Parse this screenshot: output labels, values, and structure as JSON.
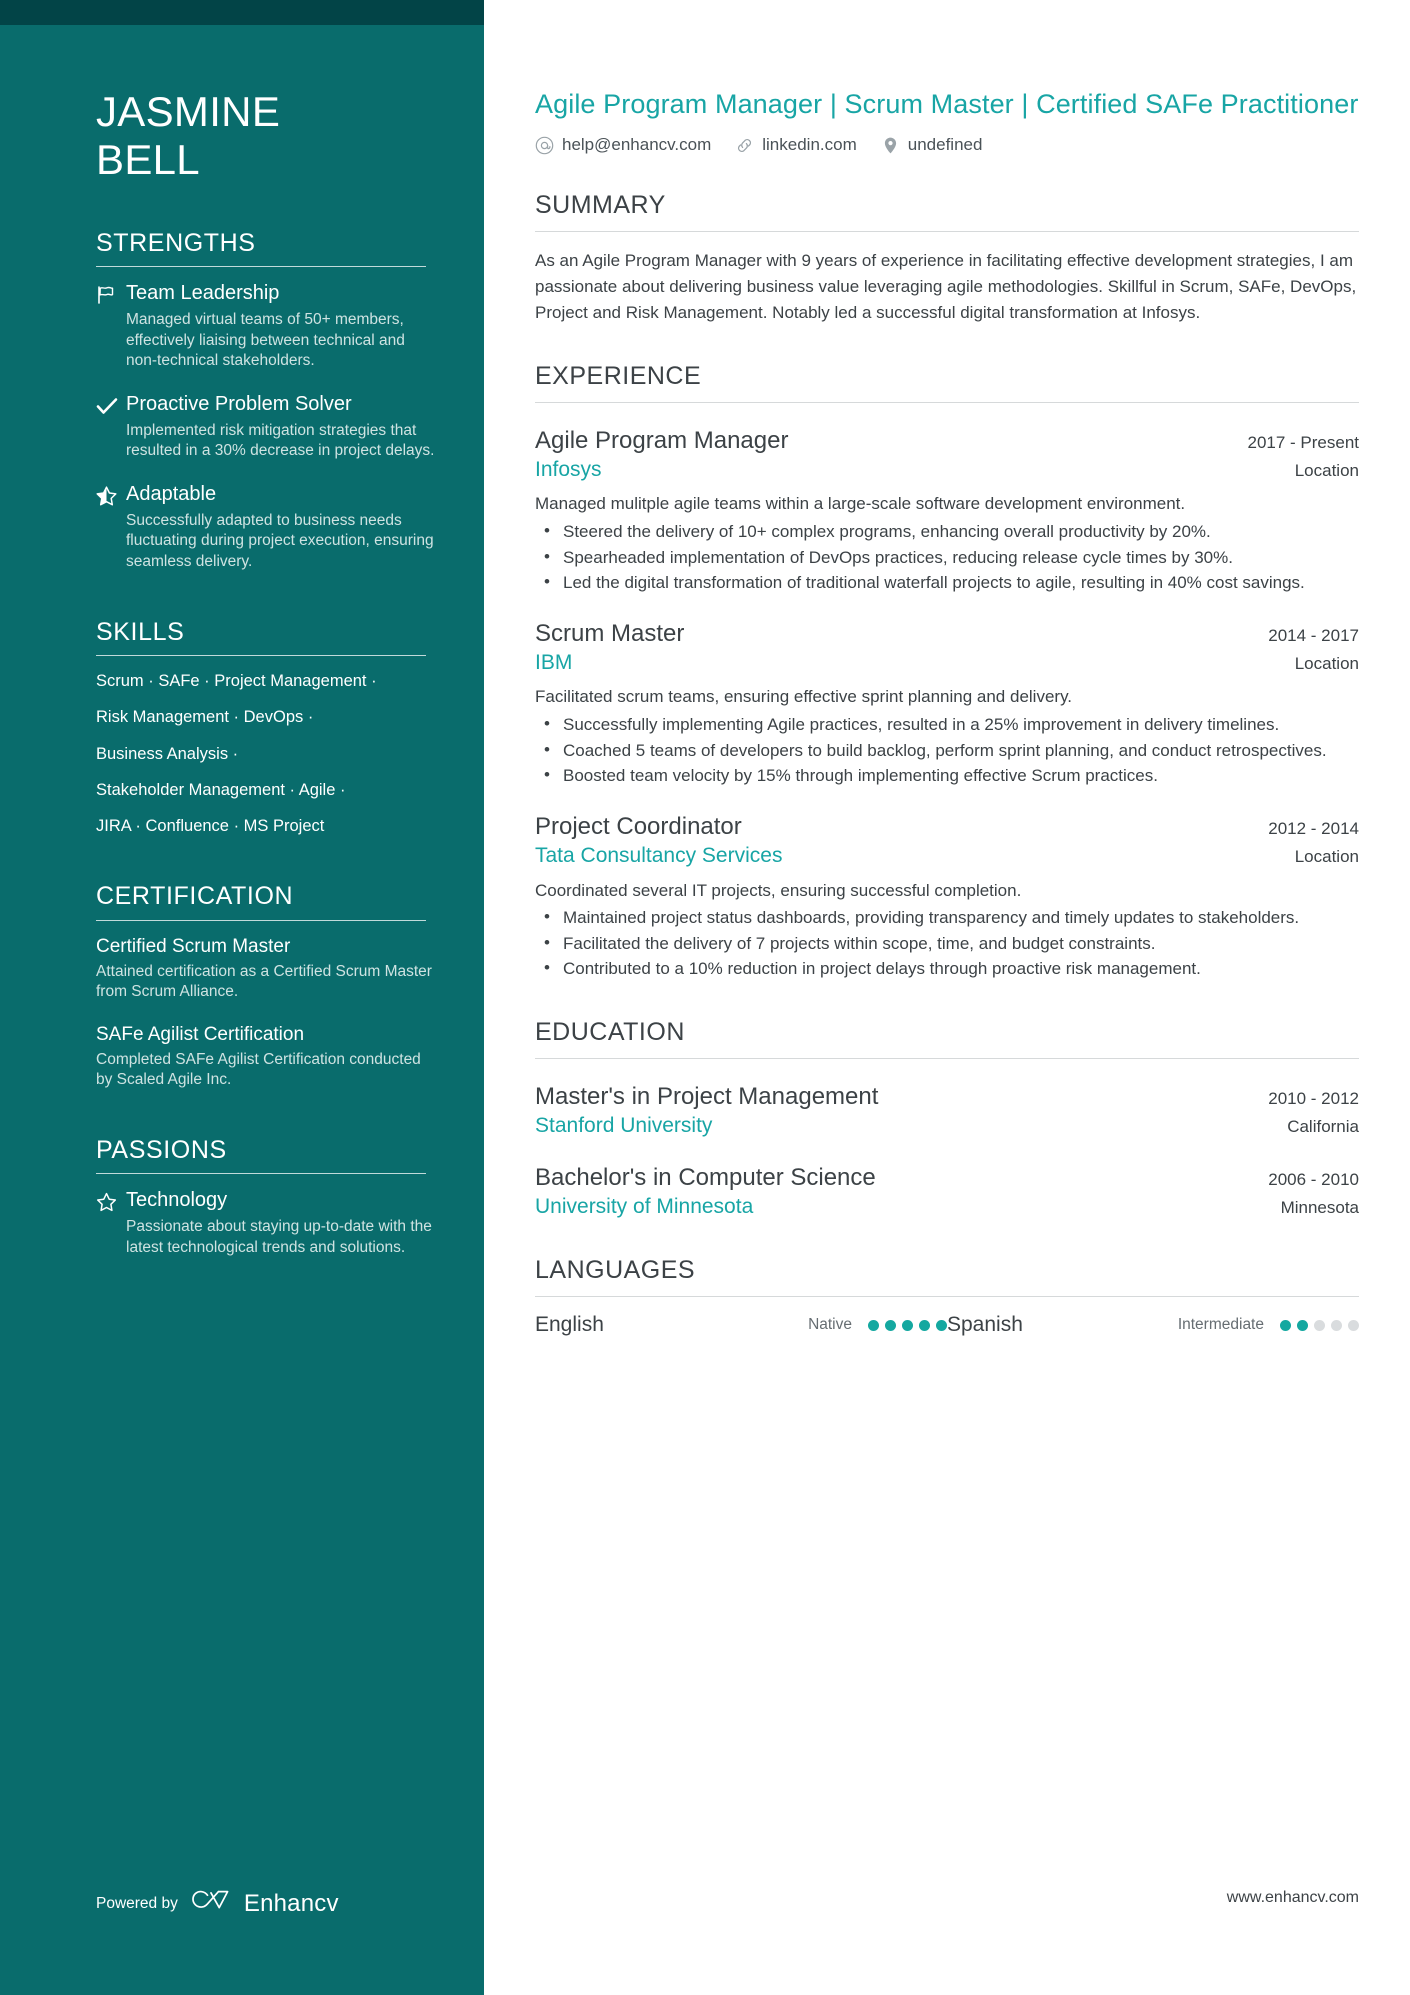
{
  "colors": {
    "sidebar_bg": "#096c6c",
    "sidebar_topband": "#024447",
    "accent_teal": "#18a5a5",
    "dot_on": "#14a8a0",
    "dot_off": "#d9dcde",
    "body_text": "#3c4246"
  },
  "sidebar": {
    "name_first": "JASMINE",
    "name_last": "BELL",
    "strengths": {
      "heading": "STRENGTHS",
      "items": [
        {
          "icon": "flag-icon",
          "title": "Team Leadership",
          "desc": "Managed virtual teams of 50+ members, effectively liaising between technical and non-technical stakeholders."
        },
        {
          "icon": "check-icon",
          "title": "Proactive Problem Solver",
          "desc": "Implemented risk mitigation strategies that resulted in a 30% decrease in project delays."
        },
        {
          "icon": "star-half-icon",
          "title": "Adaptable",
          "desc": "Successfully adapted to business needs fluctuating during project execution, ensuring seamless delivery."
        }
      ]
    },
    "skills": {
      "heading": "SKILLS",
      "lines": [
        "Scrum · SAFe · Project Management ·",
        "Risk Management · DevOps ·",
        "Business Analysis ·",
        "Stakeholder Management · Agile ·",
        "JIRA · Confluence · MS Project"
      ]
    },
    "certification": {
      "heading": "CERTIFICATION",
      "items": [
        {
          "title": "Certified Scrum Master",
          "desc": "Attained certification as a Certified Scrum Master from Scrum Alliance."
        },
        {
          "title": "SAFe Agilist Certification",
          "desc": "Completed SAFe Agilist Certification conducted by Scaled Agile Inc."
        }
      ]
    },
    "passions": {
      "heading": "PASSIONS",
      "items": [
        {
          "icon": "star-outline-icon",
          "title": "Technology",
          "desc": "Passionate about staying up-to-date with the latest technological trends and solutions."
        }
      ]
    },
    "footer": {
      "powered_by": "Powered by",
      "brand": "Enhancv"
    }
  },
  "main": {
    "headline": "Agile Program Manager | Scrum Master | Certified SAFe Practitioner",
    "contacts": [
      {
        "icon": "at-icon",
        "text": "help@enhancv.com"
      },
      {
        "icon": "link-icon",
        "text": "linkedin.com"
      },
      {
        "icon": "map-pin-icon",
        "text": "undefined"
      }
    ],
    "summary": {
      "heading": "SUMMARY",
      "text": "As an Agile Program Manager with 9 years of experience in facilitating effective development strategies, I am passionate about delivering business value leveraging agile methodologies. Skillful in Scrum, SAFe, DevOps, Project and Risk Management. Notably led a successful digital transformation at Infosys."
    },
    "experience": {
      "heading": "EXPERIENCE",
      "entries": [
        {
          "title": "Agile Program Manager",
          "date": "2017 - Present",
          "company": "Infosys",
          "location": "Location",
          "desc": "Managed mulitple agile teams within a large-scale software development environment.",
          "bullets": [
            "Steered the delivery of 10+ complex programs, enhancing overall productivity by 20%.",
            "Spearheaded implementation of DevOps practices, reducing release cycle times by 30%.",
            "Led the digital transformation of traditional waterfall projects to agile, resulting in 40% cost savings."
          ]
        },
        {
          "title": "Scrum Master",
          "date": "2014 - 2017",
          "company": "IBM",
          "location": "Location",
          "desc": "Facilitated scrum teams, ensuring effective sprint planning and delivery.",
          "bullets": [
            "Successfully implementing Agile practices, resulted in a 25% improvement in delivery timelines.",
            "Coached 5 teams of developers to build backlog, perform sprint planning, and conduct retrospectives.",
            "Boosted team velocity by 15% through implementing effective Scrum practices."
          ]
        },
        {
          "title": "Project Coordinator",
          "date": "2012 - 2014",
          "company": "Tata Consultancy Services",
          "location": "Location",
          "desc": "Coordinated several IT projects, ensuring successful completion.",
          "bullets": [
            "Maintained project status dashboards, providing transparency and timely updates to stakeholders.",
            "Facilitated the delivery of 7 projects within scope, time, and budget constraints.",
            "Contributed to a 10% reduction in project delays through proactive risk management."
          ]
        }
      ]
    },
    "education": {
      "heading": "EDUCATION",
      "entries": [
        {
          "title": "Master's in Project Management",
          "date": "2010 - 2012",
          "school": "Stanford University",
          "location": "California"
        },
        {
          "title": "Bachelor's in Computer Science",
          "date": "2006 - 2010",
          "school": "University of Minnesota",
          "location": "Minnesota"
        }
      ]
    },
    "languages": {
      "heading": "LANGUAGES",
      "items": [
        {
          "name": "English",
          "level": "Native",
          "filled": 5,
          "total": 5
        },
        {
          "name": "Spanish",
          "level": "Intermediate",
          "filled": 2,
          "total": 5
        }
      ]
    },
    "site_url": "www.enhancv.com"
  }
}
